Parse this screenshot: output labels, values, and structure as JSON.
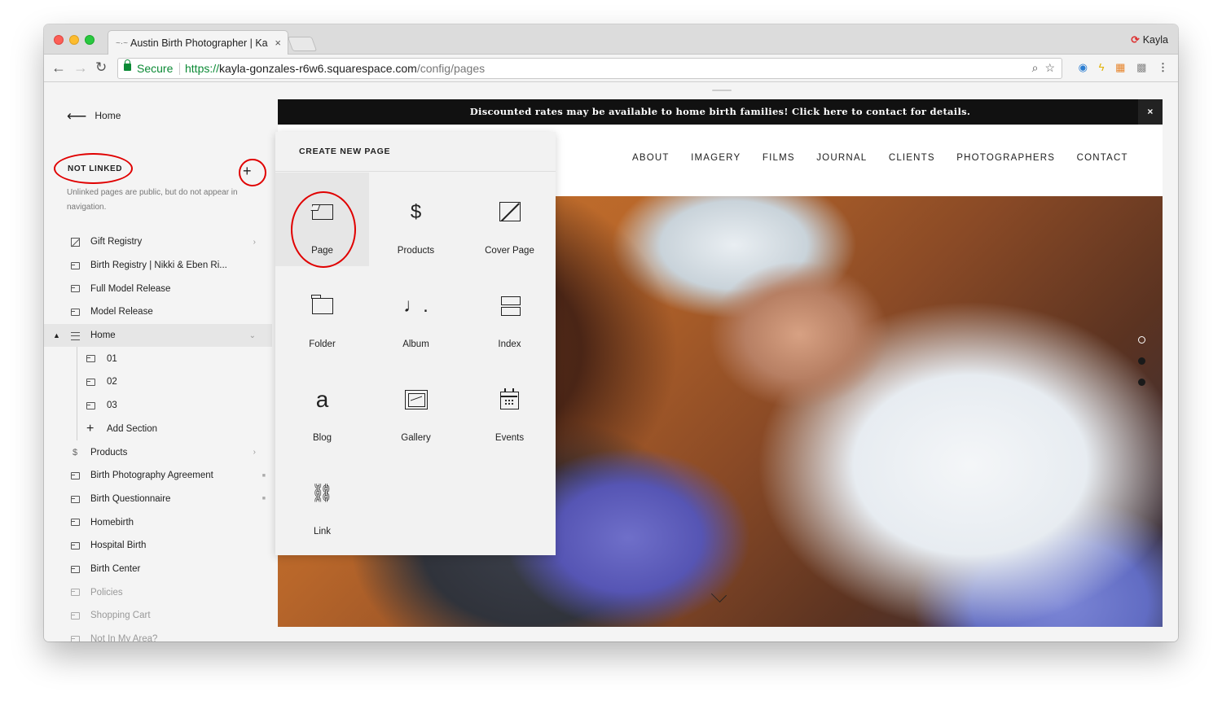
{
  "browser": {
    "tab_title": "Austin Birth Photographer | Ka",
    "profile_name": "Kayla",
    "secure_label": "Secure",
    "url_scheme": "https://",
    "url_host": "kayla-gonzales-r6w6.squarespace.com",
    "url_path": "/config/pages"
  },
  "sidebar": {
    "back_label": "Home",
    "not_linked_label": "NOT LINKED",
    "not_linked_desc": "Unlinked pages are public, but do not appear in navigation.",
    "pages": [
      {
        "label": "Gift Registry"
      },
      {
        "label": "Birth Registry | Nikki & Eben Ri..."
      },
      {
        "label": "Full Model Release"
      },
      {
        "label": "Model Release"
      },
      {
        "label": "Home"
      },
      {
        "label": "01"
      },
      {
        "label": "02"
      },
      {
        "label": "03"
      },
      {
        "label": "Add Section"
      },
      {
        "label": "Products"
      },
      {
        "label": "Birth Photography Agreement"
      },
      {
        "label": "Birth Questionnaire"
      },
      {
        "label": "Homebirth"
      },
      {
        "label": "Hospital Birth"
      },
      {
        "label": "Birth Center"
      },
      {
        "label": "Policies"
      },
      {
        "label": "Shopping Cart"
      },
      {
        "label": "Not In My Area?"
      }
    ]
  },
  "create_panel": {
    "title": "CREATE NEW PAGE",
    "tiles": [
      {
        "label": "Page",
        "icon": "page-icon"
      },
      {
        "label": "Products",
        "icon": "dollar-icon"
      },
      {
        "label": "Cover Page",
        "icon": "cover-page-icon"
      },
      {
        "label": "Folder",
        "icon": "folder-icon"
      },
      {
        "label": "Album",
        "icon": "music-note-icon"
      },
      {
        "label": "Index",
        "icon": "index-icon"
      },
      {
        "label": "Blog",
        "icon": "blog-icon"
      },
      {
        "label": "Gallery",
        "icon": "gallery-icon"
      },
      {
        "label": "Events",
        "icon": "calendar-icon"
      },
      {
        "label": "Link",
        "icon": "link-icon"
      }
    ]
  },
  "site": {
    "banner_text": "Discounted rates may be available to home birth families! Click here to contact for details.",
    "banner_close": "×",
    "nav": [
      "ABOUT",
      "IMAGERY",
      "FILMS",
      "JOURNAL",
      "CLIENTS",
      "PHOTOGRAPHERS",
      "CONTACT"
    ]
  },
  "colors": {
    "annotation_red": "#e00000",
    "secure_green": "#0b8a35",
    "banner_bg": "#111111"
  }
}
